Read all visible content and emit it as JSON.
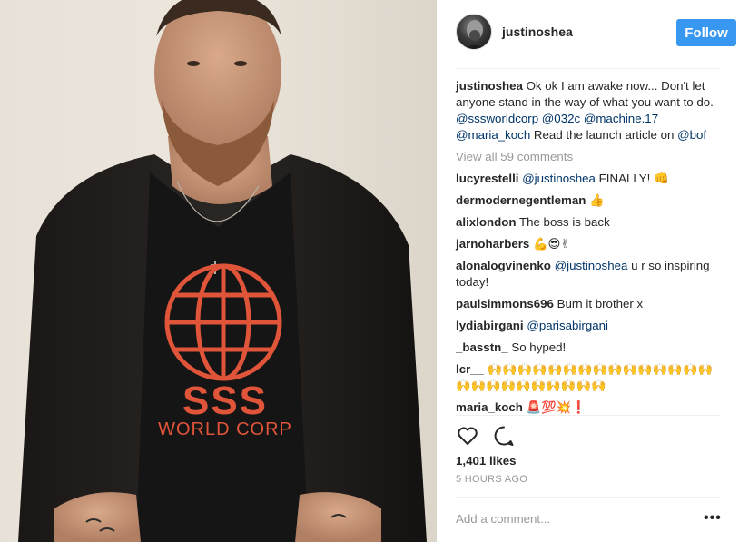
{
  "post": {
    "photo_print_top": "SSS",
    "photo_print_bottom": "WORLD CORP"
  },
  "header": {
    "username": "justinoshea",
    "follow_label": "Follow"
  },
  "caption": {
    "username": "justinoshea",
    "text_1": " Ok ok I am awake now... Don't let anyone stand in the way of what you want to do. ",
    "mention_1": "@sssworldcorp",
    "mention_2": "@032c",
    "mention_3": "@machine.17",
    "mention_4": "@maria_koch",
    "text_2": " Read the launch article on ",
    "mention_5": "@bof"
  },
  "view_all": "View all 59 comments",
  "comments": [
    {
      "user": "lucyrestelli",
      "mention": "@justinoshea",
      "text": " FINALLY! 👊"
    },
    {
      "user": "dermodernegentleman",
      "mention": "",
      "text": " 👍"
    },
    {
      "user": "alixlondon",
      "mention": "",
      "text": " The boss is back"
    },
    {
      "user": "jarnoharbers",
      "mention": "",
      "text": " 💪😎✌"
    },
    {
      "user": "alonalogvinenko",
      "mention": "@justinoshea",
      "text": " u r so inspiring today!"
    },
    {
      "user": "paulsimmons696",
      "mention": "",
      "text": " Burn it brother x"
    },
    {
      "user": "lydiabirgani",
      "mention": "@parisabirgani",
      "text": ""
    },
    {
      "user": "_basstn_",
      "mention": "",
      "text": " So hyped!"
    },
    {
      "user": "lcr__",
      "mention": "",
      "text": " 🙌🙌🙌🙌🙌🙌🙌🙌🙌🙌🙌🙌🙌🙌🙌🙌🙌🙌🙌🙌🙌🙌🙌🙌🙌"
    },
    {
      "user": "maria_koch",
      "mention": "",
      "text": " 🚨💯💥❗"
    }
  ],
  "actions": {
    "like_icon": "heart-icon",
    "comment_icon": "comment-icon"
  },
  "likes": "1,401 likes",
  "time_ago": "5 HOURS AGO",
  "add_comment_placeholder": "Add a comment...",
  "more_icon": "•••",
  "colors": {
    "follow_button": "#3897f0",
    "mention": "#003569",
    "muted": "#999999",
    "print_red": "#e0553a"
  }
}
